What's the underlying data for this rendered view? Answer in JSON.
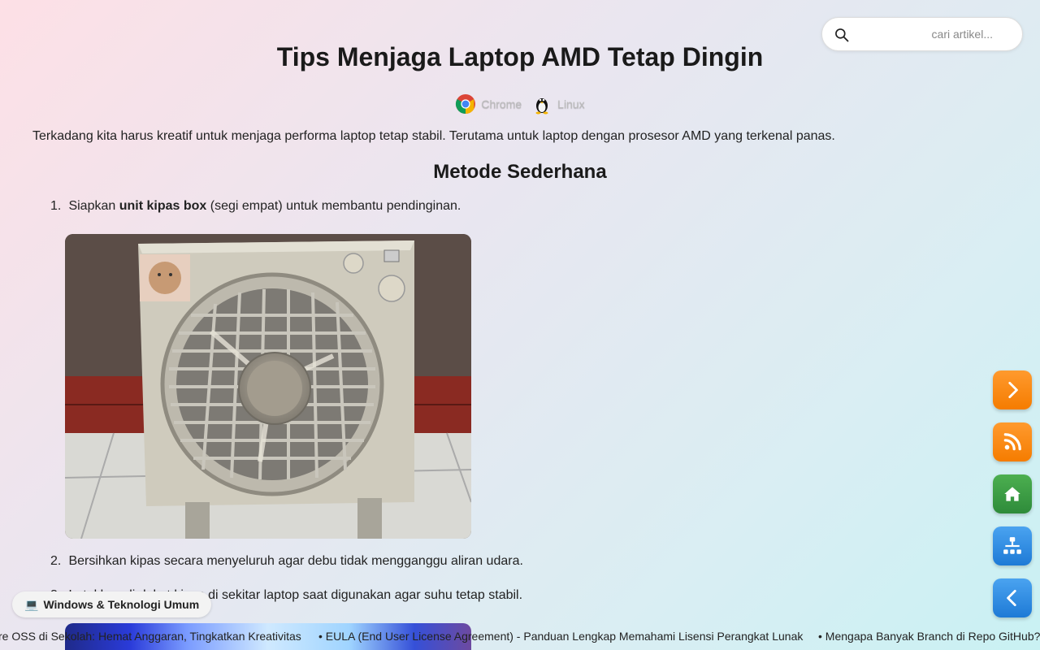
{
  "search": {
    "placeholder": "cari artikel..."
  },
  "article": {
    "title": "Tips Menjaga Laptop AMD Tetap Dingin",
    "badges": [
      {
        "label": "Chrome",
        "icon": "chrome-icon"
      },
      {
        "label": "Linux",
        "icon": "linux-tux-icon"
      }
    ],
    "intro": "Terkadang kita harus kreatif untuk menjaga performa laptop tetap stabil. Terutama untuk laptop dengan prosesor AMD yang terkenal panas.",
    "section_heading": "Metode Sederhana",
    "steps": [
      {
        "num": "1.",
        "pre": "Siapkan ",
        "bold": "unit kipas box",
        "post": " (segi empat) untuk membantu pendinginan."
      },
      {
        "num": "2.",
        "text": "Bersihkan kipas secara menyeluruh agar debu tidak mengganggu aliran udara."
      },
      {
        "num": "3.",
        "text": "Letakkan di dekat kipas di sekitar laptop saat digunakan agar suhu tetap stabil."
      }
    ]
  },
  "category_pill": {
    "icon": "laptop-emoji-icon",
    "label": "Windows & Teknologi Umum"
  },
  "ticker": {
    "items": [
      "re OSS di Sekolah: Hemat Anggaran, Tingkatkan Kreativitas",
      "EULA (End User License Agreement) - Panduan Lengkap Memahami Lisensi Perangkat Lunak",
      "Mengapa Banyak Branch di Repo GitHub?"
    ]
  },
  "fab_buttons": [
    {
      "name": "next-button",
      "icon": "chevron-right-icon",
      "color": "#f57c00"
    },
    {
      "name": "rss-button",
      "icon": "rss-icon",
      "color": "#f57c00"
    },
    {
      "name": "home-button",
      "icon": "home-icon",
      "color": "#2e8b3a"
    },
    {
      "name": "sitemap-button",
      "icon": "sitemap-icon",
      "color": "#1e7ad6"
    },
    {
      "name": "prev-button",
      "icon": "chevron-left-icon",
      "color": "#1e7ad6"
    }
  ]
}
